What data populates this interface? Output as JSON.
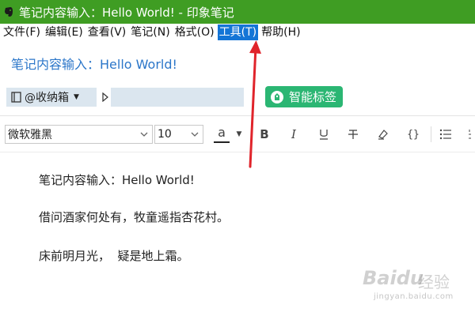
{
  "window": {
    "title": "笔记内容输入：Hello World! - 印象笔记",
    "titlebar_color": "#3f9d23",
    "icon": "evernote-elephant-icon"
  },
  "menu": {
    "items": [
      {
        "label": "文件(F)",
        "active": false
      },
      {
        "label": "编辑(E)",
        "active": false
      },
      {
        "label": "查看(V)",
        "active": false
      },
      {
        "label": "笔记(N)",
        "active": false
      },
      {
        "label": "格式(O)",
        "active": false
      },
      {
        "label": "工具(T)",
        "active": true
      },
      {
        "label": "帮助(H)",
        "active": false
      }
    ],
    "active_color": "#1475d6"
  },
  "note": {
    "title": "笔记内容输入：Hello World!",
    "title_color": "#2b76c9",
    "notebook": "@收纳箱",
    "smart_tag_label": "智能标签",
    "smart_tag_color": "#2bb673",
    "body": [
      "笔记内容输入：Hello World!",
      "借问酒家何处有，牧童遥指杏花村。",
      "床前明月光，  疑是地上霜。"
    ]
  },
  "toolbar": {
    "font_family": "微软雅黑",
    "font_size": "10",
    "color_letter": "a",
    "bold": "B",
    "italic": "I",
    "underline": "U",
    "strike": "T",
    "code": "{}"
  },
  "annotation": {
    "arrow_color": "#e0242b"
  },
  "watermark": {
    "brand": "Baidu",
    "sub": "经验",
    "url": "jingyan.baidu.com"
  }
}
